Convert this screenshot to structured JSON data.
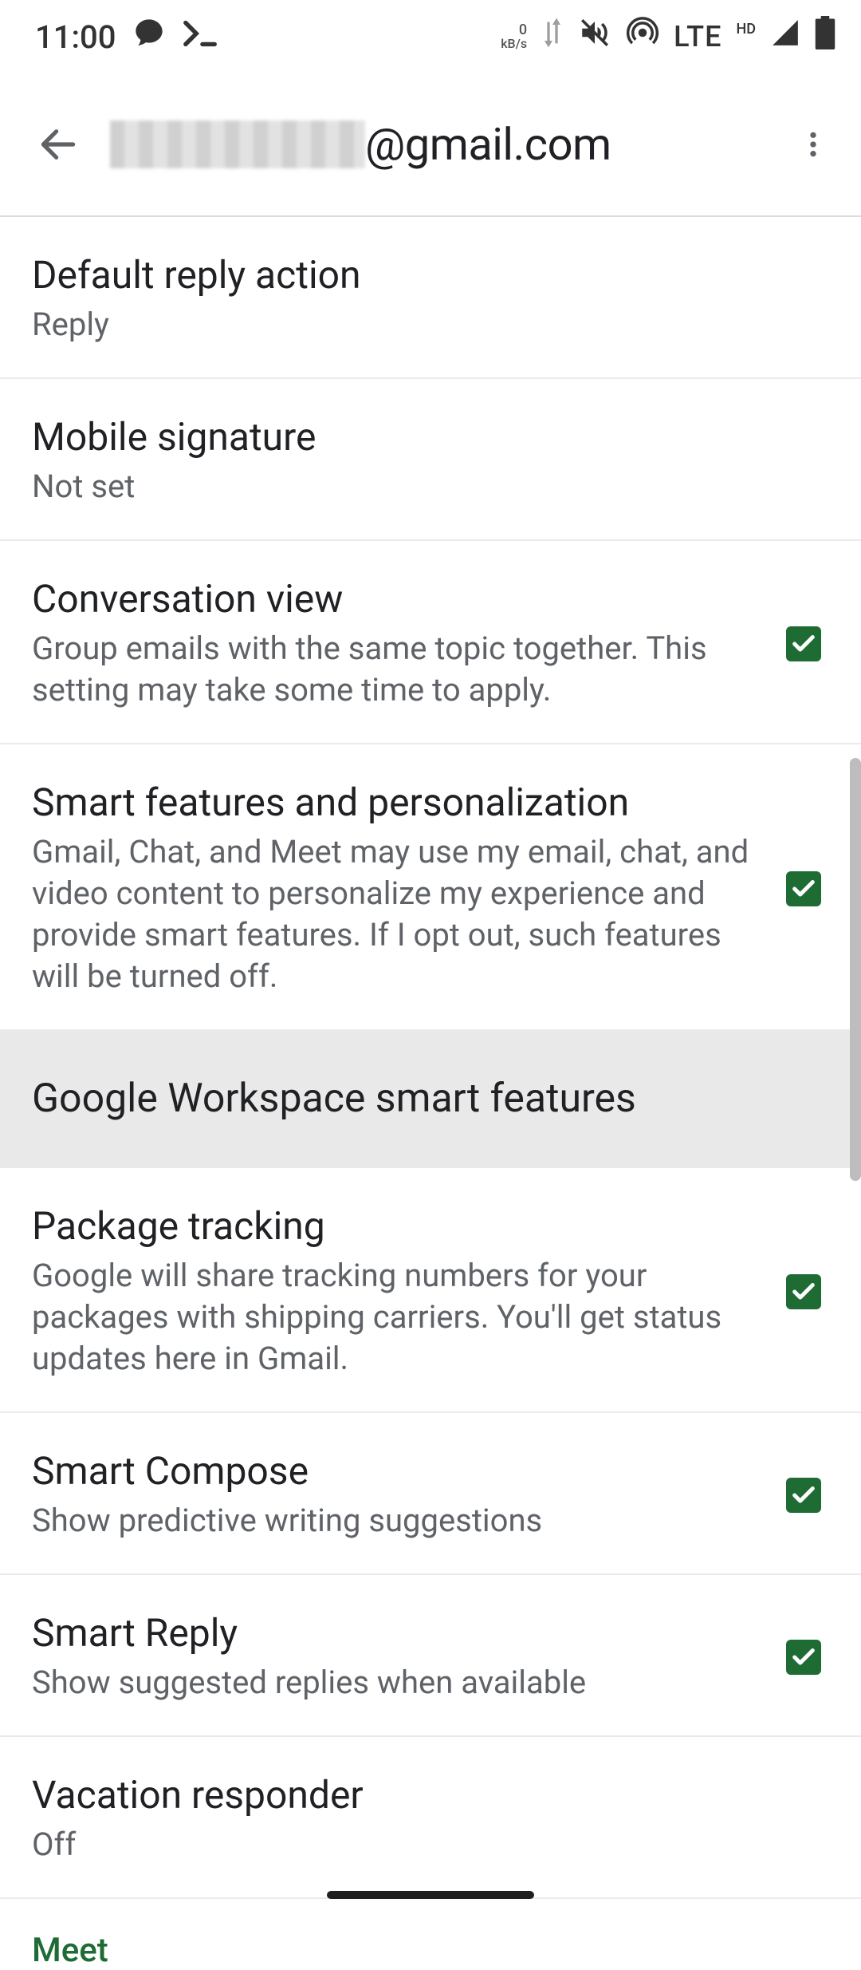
{
  "status": {
    "time": "11:00",
    "kbs_value": "0",
    "kbs_unit": "kB/s",
    "lte": "LTE",
    "hd": "HD"
  },
  "header": {
    "email_suffix": "@gmail.com"
  },
  "settings": {
    "default_reply": {
      "title": "Default reply action",
      "value": "Reply"
    },
    "mobile_signature": {
      "title": "Mobile signature",
      "value": "Not set"
    },
    "conversation_view": {
      "title": "Conversation view",
      "desc": "Group emails with the same topic together. This setting may take some time to apply."
    },
    "smart_features": {
      "title": "Smart features and personalization",
      "desc": "Gmail, Chat, and Meet may use my email, chat, and video content to personalize my experience and provide smart features. If I opt out, such features will be turned off."
    },
    "workspace": {
      "title": "Google Workspace smart features"
    },
    "package_tracking": {
      "title": "Package tracking",
      "desc": "Google will share tracking numbers for your packages with shipping carriers. You'll get status updates here in Gmail."
    },
    "smart_compose": {
      "title": "Smart Compose",
      "desc": "Show predictive writing suggestions"
    },
    "smart_reply": {
      "title": "Smart Reply",
      "desc": "Show suggested replies when available"
    },
    "vacation": {
      "title": "Vacation responder",
      "value": "Off"
    }
  },
  "section_meet": "Meet"
}
